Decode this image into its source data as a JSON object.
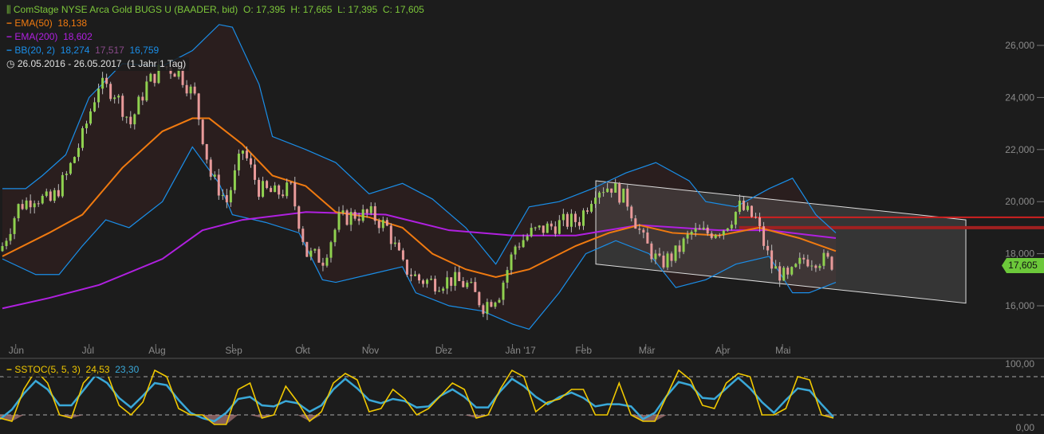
{
  "header": {
    "title": "ComStage NYSE Arca Gold BUGS U (BAADER, bid)",
    "o": "O: 17,395",
    "h": "H: 17,665",
    "l": "L: 17,395",
    "c": "C: 17,605"
  },
  "legend": {
    "ema50": {
      "label": "EMA(50)",
      "value": "18,138",
      "color": "#f07a10"
    },
    "ema200": {
      "label": "EMA(200)",
      "value": "18,602",
      "color": "#b020e0"
    },
    "bb": {
      "label": "BB(20, 2)",
      "upper": "18,274",
      "mid": "17,517",
      "lower": "16,759",
      "color": "#1a8ee8"
    },
    "range": {
      "label": "26.05.2016 - 26.05.2017",
      "period": "(1 Jahr 1 Tag)"
    }
  },
  "last_price": "17,605",
  "stoch": {
    "label": "SSTOC(5, 5, 3)",
    "k": "24,53",
    "d": "23,30"
  },
  "chart_data": [
    {
      "type": "candlestick",
      "title": "ComStage NYSE Arca Gold BUGS U",
      "ylim": [
        15000,
        27000
      ],
      "y_ticks": [
        "16,000",
        "18,000",
        "20,000",
        "22,000",
        "24,000",
        "26,000"
      ],
      "x_ticks": [
        "Jun",
        "Jul",
        "Aug",
        "Sep",
        "Okt",
        "Nov",
        "Dez",
        "Jan '17",
        "Feb",
        "Mär",
        "Apr",
        "Mai"
      ],
      "x_tick_days": [
        4,
        26,
        46,
        69,
        90,
        110,
        132,
        153,
        174,
        193,
        216,
        234
      ],
      "days": 250,
      "closes": [
        18.3,
        19.8,
        20.2,
        20.0,
        21.0,
        22.5,
        24.5,
        24.2,
        23.0,
        24.5,
        25.2,
        25.0,
        24.0,
        21.0,
        20.0,
        22.0,
        20.5,
        20.3,
        20.5,
        18.0,
        17.8,
        19.3,
        19.5,
        19.5,
        19.0,
        17.5,
        17.0,
        16.9,
        17.0,
        16.8,
        16.0,
        16.5,
        18.3,
        18.8,
        19.0,
        19.2,
        19.3,
        20.5,
        20.6,
        20.0,
        18.5,
        17.6,
        18.0,
        18.8,
        18.8,
        19.0,
        19.8,
        19.3,
        17.5,
        17.0,
        17.8,
        17.8,
        17.6
      ],
      "ema50": [
        [
          0,
          17.9
        ],
        [
          14,
          18.8
        ],
        [
          24,
          19.5
        ],
        [
          36,
          21.3
        ],
        [
          48,
          22.7
        ],
        [
          57,
          23.2
        ],
        [
          62,
          23.2
        ],
        [
          72,
          22.2
        ],
        [
          81,
          21.0
        ],
        [
          91,
          20.6
        ],
        [
          100,
          19.6
        ],
        [
          110,
          19.4
        ],
        [
          120,
          19.0
        ],
        [
          129,
          18.0
        ],
        [
          139,
          17.4
        ],
        [
          148,
          17.1
        ],
        [
          158,
          17.4
        ],
        [
          172,
          18.3
        ],
        [
          182,
          18.8
        ],
        [
          191,
          19.1
        ],
        [
          201,
          18.8
        ],
        [
          215,
          18.7
        ],
        [
          227,
          19.0
        ],
        [
          239,
          18.6
        ],
        [
          250,
          18.1
        ]
      ],
      "ema200": [
        [
          0,
          15.9
        ],
        [
          14,
          16.3
        ],
        [
          29,
          16.8
        ],
        [
          48,
          17.8
        ],
        [
          60,
          18.9
        ],
        [
          72,
          19.3
        ],
        [
          91,
          19.6
        ],
        [
          115,
          19.5
        ],
        [
          134,
          18.9
        ],
        [
          153,
          18.7
        ],
        [
          172,
          18.7
        ],
        [
          191,
          19.1
        ],
        [
          215,
          18.9
        ],
        [
          230,
          18.9
        ],
        [
          250,
          18.6
        ]
      ],
      "bb_upper": [
        [
          0,
          20.5
        ],
        [
          7,
          20.5
        ],
        [
          12,
          21.0
        ],
        [
          19,
          21.8
        ],
        [
          26,
          24.0
        ],
        [
          36,
          25.3
        ],
        [
          48,
          25.2
        ],
        [
          57,
          25.8
        ],
        [
          65,
          26.8
        ],
        [
          69,
          26.7
        ],
        [
          77,
          24.5
        ],
        [
          81,
          22.5
        ],
        [
          91,
          22.0
        ],
        [
          100,
          21.5
        ],
        [
          110,
          20.3
        ],
        [
          120,
          20.7
        ],
        [
          129,
          20.1
        ],
        [
          139,
          19.0
        ],
        [
          148,
          17.6
        ],
        [
          158,
          19.8
        ],
        [
          167,
          20.0
        ],
        [
          177,
          20.5
        ],
        [
          187,
          21.1
        ],
        [
          196,
          21.5
        ],
        [
          206,
          20.8
        ],
        [
          211,
          20.0
        ],
        [
          220,
          19.8
        ],
        [
          230,
          20.5
        ],
        [
          237,
          20.9
        ],
        [
          244,
          19.5
        ],
        [
          250,
          18.8
        ]
      ],
      "bb_lower": [
        [
          0,
          17.8
        ],
        [
          10,
          17.2
        ],
        [
          17,
          17.2
        ],
        [
          24,
          18.3
        ],
        [
          31,
          19.3
        ],
        [
          38,
          19.0
        ],
        [
          48,
          20.0
        ],
        [
          57,
          22.1
        ],
        [
          65,
          20.7
        ],
        [
          69,
          19.5
        ],
        [
          79,
          19.2
        ],
        [
          89,
          18.8
        ],
        [
          96,
          17.0
        ],
        [
          100,
          16.9
        ],
        [
          110,
          17.2
        ],
        [
          120,
          17.5
        ],
        [
          124,
          16.5
        ],
        [
          134,
          16.0
        ],
        [
          144,
          15.8
        ],
        [
          153,
          15.3
        ],
        [
          158,
          15.1
        ],
        [
          167,
          16.5
        ],
        [
          175,
          18.0
        ],
        [
          184,
          18.5
        ],
        [
          194,
          18.0
        ],
        [
          202,
          16.7
        ],
        [
          211,
          17.0
        ],
        [
          220,
          17.6
        ],
        [
          230,
          17.9
        ],
        [
          237,
          16.5
        ],
        [
          242,
          16.5
        ],
        [
          250,
          16.9
        ]
      ],
      "channel": {
        "upper": [
          [
            178,
            20.8
          ],
          [
            289,
            19.3
          ]
        ],
        "lower": [
          [
            178,
            17.6
          ],
          [
            289,
            16.1
          ]
        ]
      },
      "resistance": [
        {
          "from_day": 221,
          "value": 19.4
        },
        {
          "from_day": 221,
          "value": 19.0
        }
      ]
    },
    {
      "type": "line",
      "title": "SSTOC(5, 5, 3)",
      "ylim": [
        0,
        100
      ],
      "y_ticks": [
        "0,00",
        "100,00"
      ],
      "levels": [
        20,
        80
      ],
      "k": [
        15,
        10,
        60,
        90,
        70,
        20,
        15,
        70,
        90,
        85,
        35,
        20,
        40,
        90,
        80,
        30,
        20,
        20,
        5,
        5,
        60,
        70,
        15,
        20,
        65,
        40,
        10,
        25,
        70,
        85,
        75,
        25,
        30,
        60,
        45,
        20,
        30,
        50,
        70,
        60,
        15,
        20,
        60,
        90,
        80,
        25,
        40,
        45,
        60,
        60,
        20,
        20,
        70,
        20,
        10,
        10,
        50,
        90,
        75,
        35,
        30,
        70,
        85,
        80,
        20,
        20,
        30,
        80,
        75,
        20,
        15
      ]
    }
  ]
}
